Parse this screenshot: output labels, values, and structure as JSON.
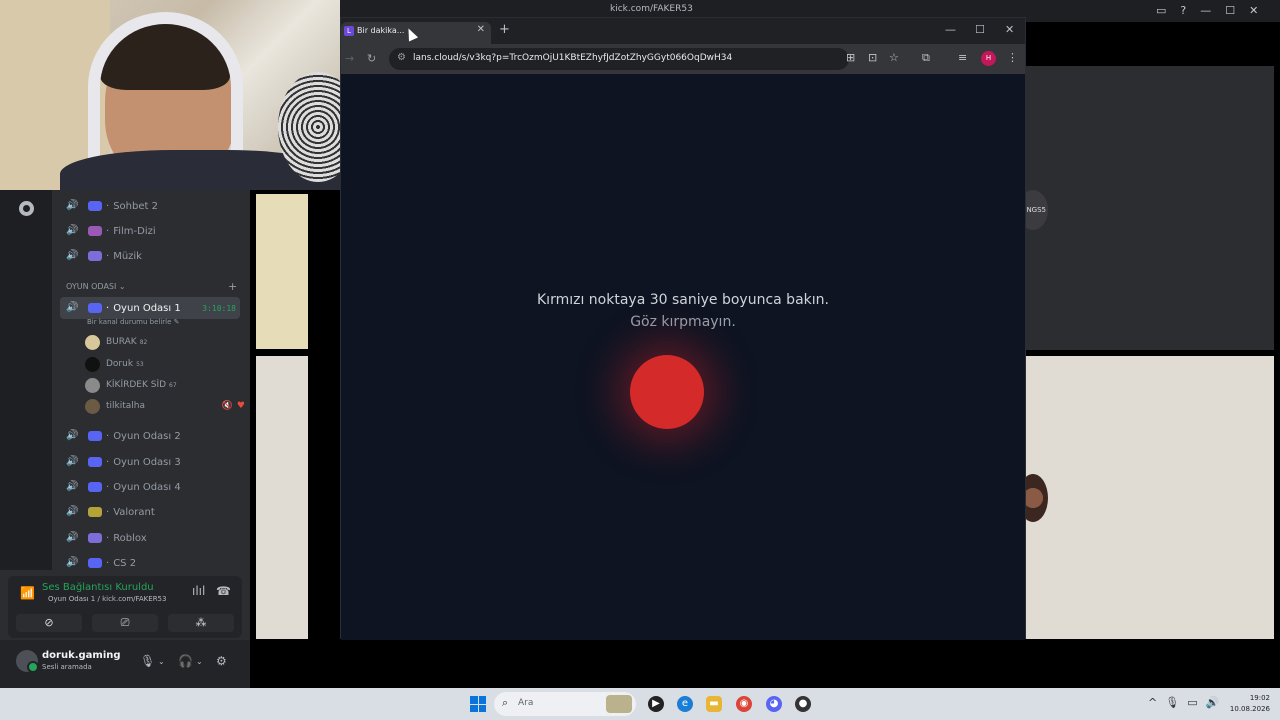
{
  "top_window": {
    "title": "kick.com/FAKER53",
    "controls": [
      "▭",
      "?",
      "—",
      "☐",
      "✕"
    ]
  },
  "browser": {
    "tab_title": "Bir dakika...",
    "tab_favicon": "L",
    "url": "lans.cloud/s/v3kq?p=TrcOzmOjU1KBtEZhyfJdZotZhyGGyt066OqDwH34",
    "profile_initial": "H",
    "page": {
      "instruction": "Kırmızı noktaya 30 saniye boyunca bakın.",
      "subtext": "Göz kırpmayın.",
      "dot_color": "#d42a2a"
    }
  },
  "discord": {
    "channels_top": [
      {
        "label": "Sohbet 2",
        "icon": "chat-icon"
      },
      {
        "label": "Film-Dizi",
        "icon": "film-icon"
      },
      {
        "label": "Müzik",
        "icon": "music-icon"
      }
    ],
    "category": "OYUN ODASI",
    "active_channel": {
      "label": "Oyun Odası 1",
      "timer": "3:10:18",
      "status": "Bir kanal durumu belirle"
    },
    "members": [
      {
        "name": "BURAK",
        "tag": "82"
      },
      {
        "name": "Doruk",
        "tag": "53"
      },
      {
        "name": "KİKİRDEK SİD",
        "tag": "67"
      },
      {
        "name": "tilkitalha",
        "tag": ""
      }
    ],
    "channels_bottom": [
      {
        "label": "Oyun Odası 2"
      },
      {
        "label": "Oyun Odası 3"
      },
      {
        "label": "Oyun Odası 4"
      },
      {
        "label": "Valorant"
      },
      {
        "label": "Roblox"
      },
      {
        "label": "CS 2"
      }
    ],
    "voice": {
      "status": "Ses Bağlantısı Kuruldu",
      "location": "Oyun Odası 1 / kick.com/FAKER53"
    },
    "user": {
      "name": "doruk.gaming",
      "status": "Sesli aramada"
    },
    "accent_green": "#23a55a"
  },
  "tiles": {
    "logo_text": "NGS5"
  },
  "taskbar": {
    "search_placeholder": "Ara",
    "time": "19:02",
    "date": "10.08.2026"
  }
}
